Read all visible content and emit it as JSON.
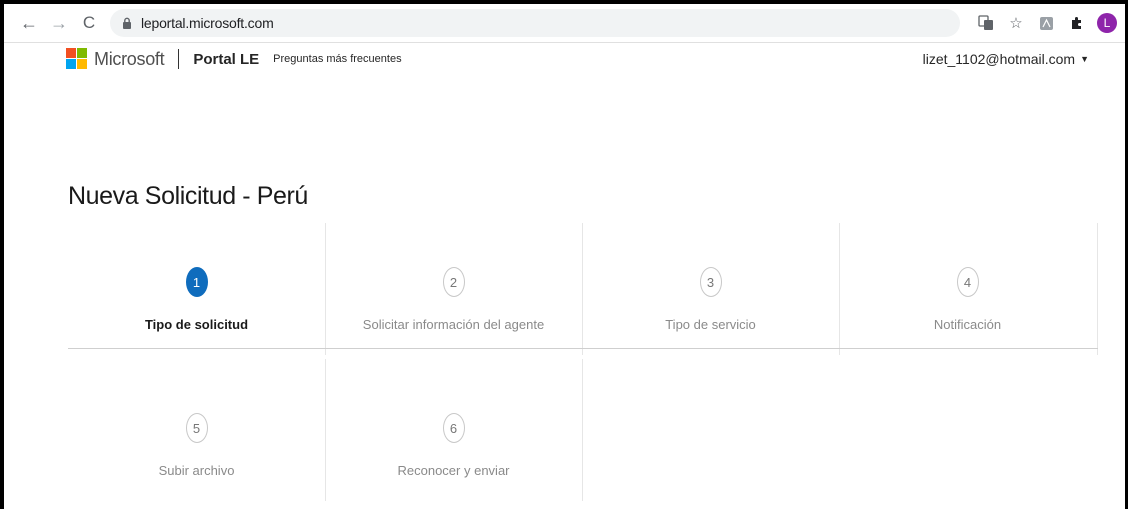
{
  "browser": {
    "url": "leportal.microsoft.com",
    "avatar_letter": "L",
    "back_glyph": "←",
    "forward_glyph": "→",
    "reload_glyph": "C",
    "icons": [
      "translate-icon",
      "star-icon",
      "pdf-extension-icon",
      "extensions-puzzle-icon"
    ]
  },
  "header": {
    "brand": "Microsoft",
    "portal": "Portal LE",
    "faq": "Preguntas más frecuentes",
    "user": "lizet_1102@hotmail.com",
    "caret": "▼",
    "logo_colors": [
      "#f25022",
      "#7fba00",
      "#00a4ef",
      "#ffb900"
    ]
  },
  "page": {
    "title": "Nueva Solicitud - Perú"
  },
  "steps": [
    {
      "number": "1",
      "label": "Tipo de solicitud",
      "active": true
    },
    {
      "number": "2",
      "label": "Solicitar información del agente",
      "active": false
    },
    {
      "number": "3",
      "label": "Tipo de servicio",
      "active": false
    },
    {
      "number": "4",
      "label": "Notificación",
      "active": false
    },
    {
      "number": "5",
      "label": "Subir archivo",
      "active": false
    },
    {
      "number": "6",
      "label": "Reconocer y enviar",
      "active": false
    }
  ],
  "colors": {
    "accent": "#0f6cbd",
    "avatar": "#8e24aa"
  }
}
